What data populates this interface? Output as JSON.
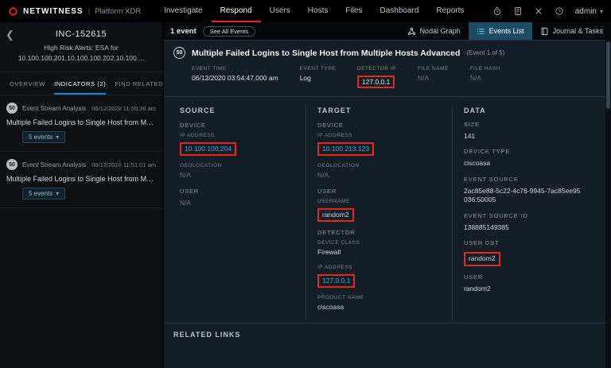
{
  "colors": {
    "brand_red": "#d8242c",
    "nav_active_underline": "#e0242b",
    "tab_active_blue": "#0c8bd0",
    "link_blue": "#4aa3d8",
    "annotation_red": "#e2271c",
    "panel_bg": "#131d25"
  },
  "nav": {
    "brand": "NETWITNESS",
    "brand_suffix": "Platform XDR",
    "items": [
      {
        "label": "Investigate"
      },
      {
        "label": "Respond"
      },
      {
        "label": "Users"
      },
      {
        "label": "Hosts"
      },
      {
        "label": "Files"
      },
      {
        "label": "Dashboard"
      },
      {
        "label": "Reports"
      }
    ],
    "admin_label": "admin"
  },
  "sidebar": {
    "incident_id": "INC-152615",
    "incident_title": "High Risk Alerts: ESA for 10.100.100.201,10.100.100.202,10.100....",
    "tabs": [
      {
        "label": "OVERVIEW"
      },
      {
        "label": "INDICATORS (2)"
      },
      {
        "label": "FIND RELATED"
      }
    ],
    "indicators": [
      {
        "score": "50",
        "source": "Event Stream Analysis",
        "time": "06/12/2020 11:50:36 am",
        "title": "Multiple Failed Logins to Single Host from Multiple Host...",
        "events_label": "5 events"
      },
      {
        "score": "50",
        "source": "Event Stream Analysis",
        "time": "06/12/2020 11:51:01 am",
        "title": "Multiple Failed Logins to Single Host from Multiple Host...",
        "events_label": "5 events"
      }
    ]
  },
  "toolbar": {
    "event_count": "1 event",
    "see_all_label": "See All Events",
    "views": [
      {
        "label": "Nodal Graph"
      },
      {
        "label": "Events List"
      },
      {
        "label": "Journal & Tasks"
      }
    ]
  },
  "event": {
    "score": "50",
    "title": "Multiple Failed Logins to Single Host from Multiple Hosts Advanced",
    "subtitle": "(Event 1 of 5)",
    "meta": [
      {
        "label": "EVENT TIME",
        "value": "06/12/2020 03:54:47.000 am"
      },
      {
        "label": "EVENT TYPE",
        "value": "Log"
      },
      {
        "label": "DETECTOR IP",
        "value": "127.0.0.1"
      },
      {
        "label": "FILE NAME",
        "value": "N/A"
      },
      {
        "label": "FILE HASH",
        "value": "N/A"
      }
    ],
    "source": {
      "heading": "SOURCE",
      "device_heading": "DEVICE",
      "ip_label": "IP ADDRESS",
      "ip_value": "10.100.100.204",
      "geo_label": "GEOLOCATION",
      "geo_value": "N/A",
      "user_heading": "USER",
      "user_value": "N/A"
    },
    "target": {
      "heading": "TARGET",
      "device_heading": "DEVICE",
      "ip_label": "IP ADDRESS",
      "ip_value": "10.100.213.123",
      "geo_label": "GEOLOCATION",
      "geo_value": "N/A",
      "user_heading": "USER",
      "username_label": "USERNAME",
      "username_value": "random2",
      "detector_heading": "DETECTOR",
      "device_class_label": "DEVICE CLASS",
      "device_class_value": "Firewall",
      "detector_ip_label": "IP ADDRESS",
      "detector_ip_value": "127.0.0.1",
      "product_label": "PRODUCT NAME",
      "product_value": "ciscoasa"
    },
    "data": {
      "heading": "DATA",
      "size_label": "SIZE",
      "size_value": "141",
      "device_type_label": "DEVICE TYPE",
      "device_type_value": "ciscoasa",
      "event_source_label": "EVENT SOURCE",
      "event_source_value": "2ac85e88-5c22-4c76-9945-7ac85ee95036:50005",
      "event_source_id_label": "EVENT SOURCE ID",
      "event_source_id_value": "138885149385",
      "user_dst_label": "USER DST",
      "user_dst_value": "random2",
      "user_label": "USER",
      "user_value": "random2"
    },
    "related_links_label": "RELATED LINKS"
  }
}
